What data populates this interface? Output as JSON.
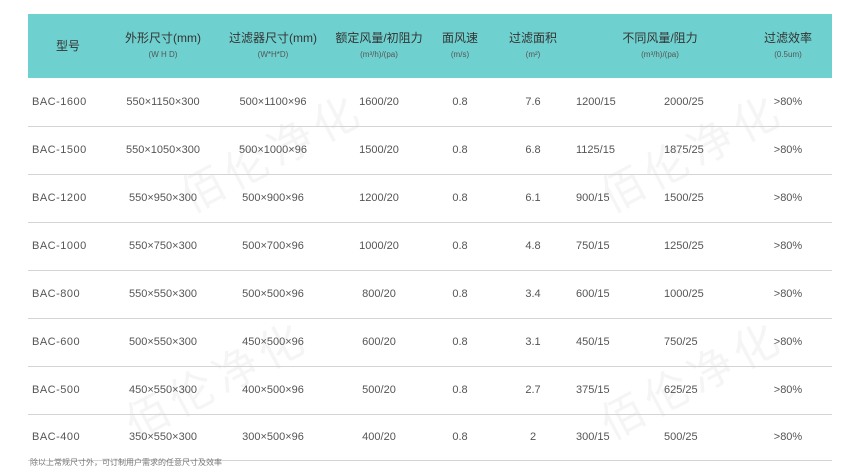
{
  "header": {
    "model": {
      "title": "型号",
      "sub": ""
    },
    "outer_size": {
      "title": "外形尺寸(mm)",
      "sub": "(W H D)"
    },
    "filter_size": {
      "title": "过滤器尺寸(mm)",
      "sub": "(W*H*D)"
    },
    "rated_airflow": {
      "title": "额定风量/初阻力",
      "sub": "(m³/h)/(pa)"
    },
    "face_velocity": {
      "title": "面风速",
      "sub": "(m/s)"
    },
    "filter_area": {
      "title": "过滤面积",
      "sub": "(m²)"
    },
    "airflow_resistance": {
      "title": "不同风量/阻力",
      "sub": "(m³/h)/(pa)"
    },
    "efficiency": {
      "title": "过滤效率",
      "sub": "(0.5um)"
    }
  },
  "rows": [
    {
      "model": "BAC-1600",
      "outer": "550×1150×300",
      "filter": "500×1100×96",
      "rated": "1600/20",
      "velocity": "0.8",
      "area": "7.6",
      "r1": "1200/15",
      "r2": "2000/25",
      "eff": ">80%"
    },
    {
      "model": "BAC-1500",
      "outer": "550×1050×300",
      "filter": "500×1000×96",
      "rated": "1500/20",
      "velocity": "0.8",
      "area": "6.8",
      "r1": "1125/15",
      "r2": "1875/25",
      "eff": ">80%"
    },
    {
      "model": "BAC-1200",
      "outer": "550×950×300",
      "filter": "500×900×96",
      "rated": "1200/20",
      "velocity": "0.8",
      "area": "6.1",
      "r1": "900/15",
      "r2": "1500/25",
      "eff": ">80%"
    },
    {
      "model": "BAC-1000",
      "outer": "550×750×300",
      "filter": "500×700×96",
      "rated": "1000/20",
      "velocity": "0.8",
      "area": "4.8",
      "r1": "750/15",
      "r2": "1250/25",
      "eff": ">80%"
    },
    {
      "model": "BAC-800",
      "outer": "550×550×300",
      "filter": "500×500×96",
      "rated": "800/20",
      "velocity": "0.8",
      "area": "3.4",
      "r1": "600/15",
      "r2": "1000/25",
      "eff": ">80%"
    },
    {
      "model": "BAC-600",
      "outer": "500×550×300",
      "filter": "450×500×96",
      "rated": "600/20",
      "velocity": "0.8",
      "area": "3.1",
      "r1": "450/15",
      "r2": "750/25",
      "eff": ">80%"
    },
    {
      "model": "BAC-500",
      "outer": "450×550×300",
      "filter": "400×500×96",
      "rated": "500/20",
      "velocity": "0.8",
      "area": "2.7",
      "r1": "375/15",
      "r2": "625/25",
      "eff": ">80%"
    },
    {
      "model": "BAC-400",
      "outer": "350×550×300",
      "filter": "300×500×96",
      "rated": "400/20",
      "velocity": "0.8",
      "area": "2",
      "r1": "300/15",
      "r2": "500/25",
      "eff": ">80%"
    }
  ],
  "footnote": "除以上常规尺寸外，可订制用户需求的任意尺寸及效率",
  "watermark": "佰伦净化",
  "colors": {
    "header_bg": "#6fd1cf",
    "row_divider": "#d4d4d4"
  }
}
